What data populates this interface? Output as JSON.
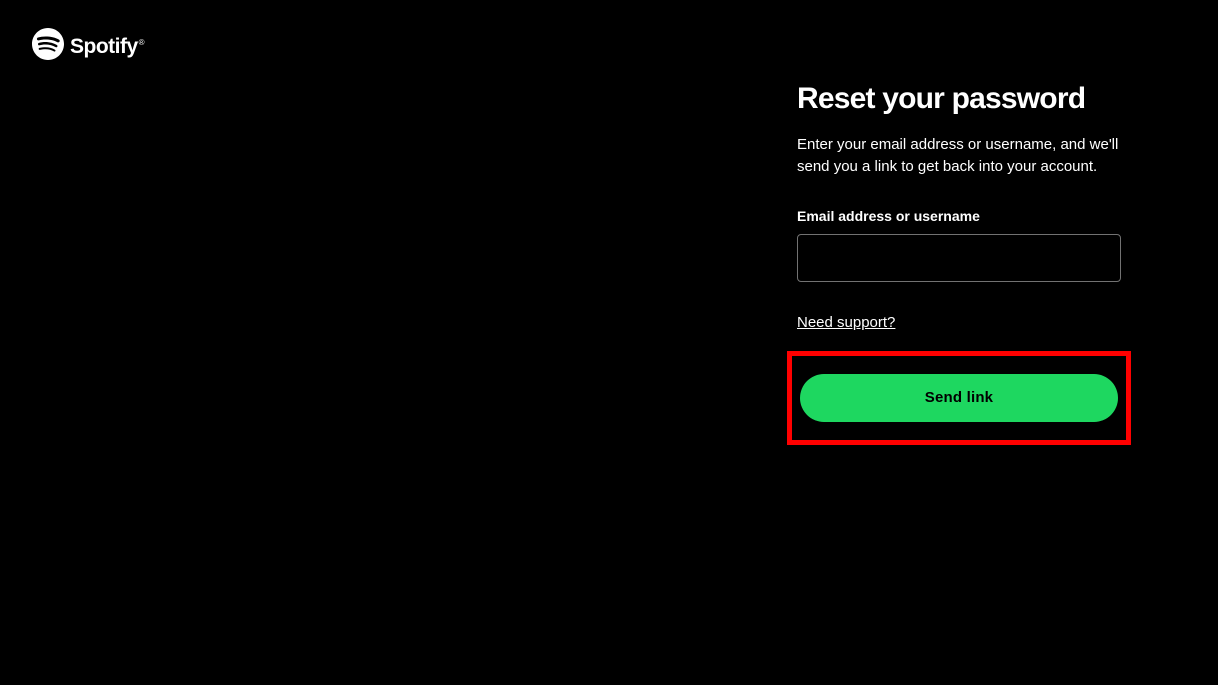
{
  "logo": {
    "brand_name": "Spotify"
  },
  "form": {
    "heading": "Reset your password",
    "description": "Enter your email address or username, and we'll send you a link to get back into your account.",
    "field_label": "Email address or username",
    "input_value": "",
    "support_link_text": "Need support?",
    "submit_button_label": "Send link"
  }
}
